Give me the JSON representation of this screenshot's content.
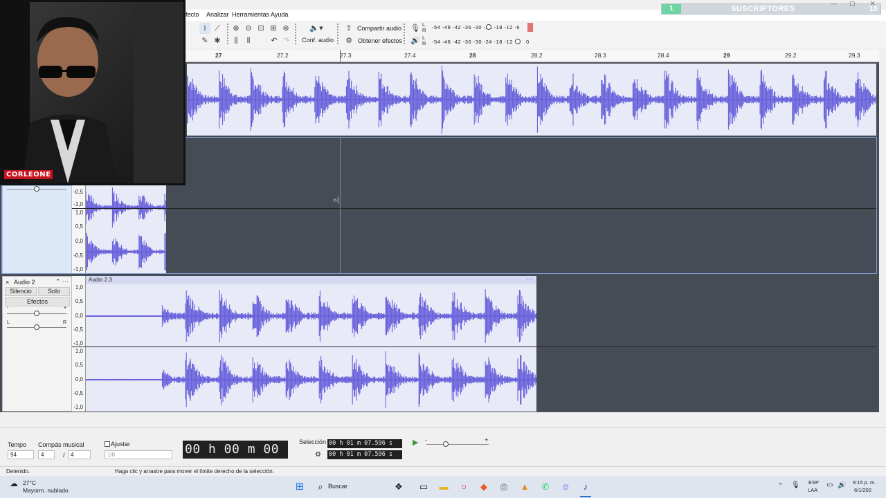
{
  "menubar": {
    "items": [
      "fecto",
      "Analizar",
      "Herramientas",
      "Ayuda"
    ]
  },
  "overlay": {
    "subs_label": "SUSCRIPTORES",
    "subs_current": "1",
    "subs_goal": "10"
  },
  "toolbar": {
    "audio_setup_label": "Conf. audio",
    "share_audio_label": "Compartir audio",
    "get_effects_label": "Obtener efectos",
    "record_meter_scale": "-54  -48  -42  -36  -30  -24  -18  -12  -6",
    "play_meter_scale": "-54  -48  -42  -36  -30  -24  -18  -12",
    "meter_end_zero": "0",
    "meter_lr": "L R"
  },
  "ruler": {
    "ticks": [
      "27",
      "27.2",
      "27.3",
      "27.4",
      "28",
      "28.2",
      "28.3",
      "28.4",
      "29",
      "29.2",
      "29.3"
    ]
  },
  "tracks": {
    "amp_labels_top": [
      "-0,5",
      "-1,0"
    ],
    "amp_labels_full": [
      "1,0",
      "0,5",
      "0,0",
      "-0,5",
      "-1,0"
    ],
    "track2": {
      "name": "Audio 2",
      "clip_name": "Audio 2.3",
      "mute_label": "Silencio",
      "solo_label": "Solo",
      "effects_label": "Efectos",
      "gain_minus": "-",
      "gain_plus": "+",
      "pan_left": "L",
      "pan_right": "R",
      "close_glyph": "×",
      "menu_dots": "···"
    }
  },
  "bottom": {
    "tempo_label": "Tempo",
    "tempo_value": "94",
    "time_sig_label": "Compás musical",
    "time_sig_num": "4",
    "time_sig_den": "4",
    "time_sig_slash": "/",
    "snap_label": "Ajustar",
    "snap_value": "1/8",
    "big_time": "00 h 00 m 00 s",
    "selection_label": "Selección",
    "selection_start": "00 h 01 m 07.596 s",
    "selection_end": "00 h 01 m 07.596 s",
    "play_speed_minus": "-",
    "play_speed_plus": "+"
  },
  "status": {
    "left": "Detenido.",
    "hint": "Haga clic y arrastre para mover el límite derecho de la selección."
  },
  "taskbar": {
    "weather_temp": "27°C",
    "weather_desc": "Mayorm. nublado",
    "search_label": "Buscar",
    "lang_top": "ESP",
    "lang_bottom": "LAA",
    "time": "8:15 p. m.",
    "date": "6/1/202"
  },
  "webcam": {
    "name_tag": "CORLEONE"
  },
  "colors": {
    "waveform": "#5f56d9",
    "clip_bg": "#e8eaf8",
    "track_bg": "#464c56",
    "accent": "#2f6fd0"
  },
  "icons": [
    "select-tool-icon",
    "envelope-tool-icon",
    "draw-tool-icon",
    "multi-tool-icon",
    "zoom-in-icon",
    "zoom-out-icon",
    "fit-selection-icon",
    "fit-project-icon",
    "zoom-toggle-icon",
    "trim-icon",
    "silence-icon",
    "undo-icon",
    "redo-icon",
    "speaker-icon",
    "share-icon",
    "effects-icon",
    "mic-icon",
    "play-icon",
    "gear-icon",
    "search-icon",
    "windows-icon"
  ]
}
